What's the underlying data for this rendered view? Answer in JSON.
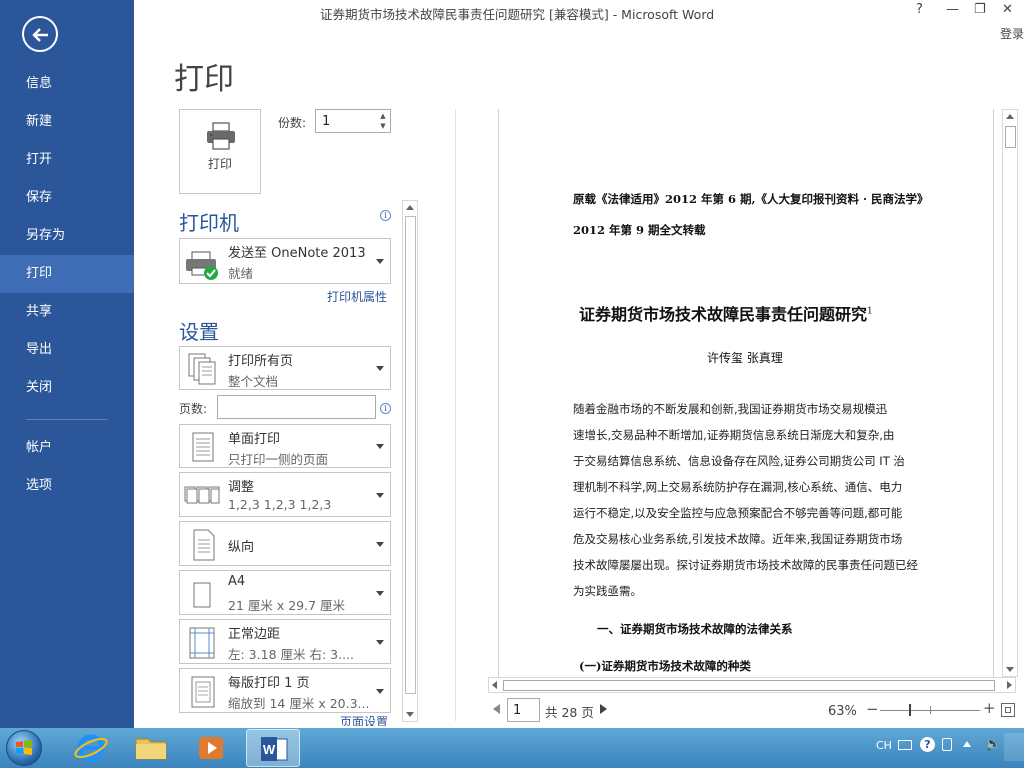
{
  "window": {
    "title": "证券期货市场技术故障民事责任问题研究 [兼容模式] - Microsoft Word",
    "help": "?",
    "minimize": "—",
    "restore": "❐",
    "close": "✕",
    "login": "登录"
  },
  "sidebar": {
    "items": [
      {
        "label": "信息"
      },
      {
        "label": "新建"
      },
      {
        "label": "打开"
      },
      {
        "label": "保存"
      },
      {
        "label": "另存为"
      },
      {
        "label": "打印",
        "active": true
      },
      {
        "label": "共享"
      },
      {
        "label": "导出"
      },
      {
        "label": "关闭"
      },
      {
        "label": "帐户"
      },
      {
        "label": "选项"
      }
    ]
  },
  "print": {
    "page_title": "打印",
    "button_label": "打印",
    "copies_label": "份数:",
    "copies_value": "1",
    "printer_heading": "打印机",
    "printer_name": "发送至 OneNote 2013",
    "printer_status": "就绪",
    "printer_properties_link": "打印机属性",
    "settings_heading": "设置",
    "pages_label": "页数:",
    "pages_value": "",
    "page_setup_link": "页面设置",
    "settings": [
      {
        "line1": "打印所有页",
        "line2": "整个文档",
        "icon": "pages-stack-icon"
      },
      {
        "line1": "单面打印",
        "line2": "只打印一侧的页面",
        "icon": "one-sided-icon"
      },
      {
        "line1": "调整",
        "line2": "1,2,3    1,2,3    1,2,3",
        "icon": "collate-icon"
      },
      {
        "line1": "纵向",
        "line2": "",
        "icon": "portrait-icon"
      },
      {
        "line1": "A4",
        "line2": "21 厘米 x 29.7 厘米",
        "icon": "paper-size-icon"
      },
      {
        "line1": "正常边距",
        "line2": "左: 3.18 厘米    右: 3....",
        "icon": "margins-icon"
      },
      {
        "line1": "每版打印 1 页",
        "line2": "缩放到 14 厘米 x 20.3...",
        "icon": "pages-per-sheet-icon"
      }
    ]
  },
  "preview": {
    "header_line1": "原载《法律适用》2012 年第 6 期,《人大复印报刊资料 · 民商法学》",
    "header_line2": "2012 年第 9 期全文转载",
    "doc_title": "证券期货市场技术故障民事责任问题研究",
    "doc_title_sup": "1",
    "authors": "许传玺  张真理",
    "body": [
      "    随着金融市场的不断发展和创新,我国证券期货市场交易规模迅",
      "速增长,交易品种不断增加,证券期货信息系统日渐庞大和复杂,由",
      "于交易结算信息系统、信息设备存在风险,证券公司期货公司 IT 治",
      "理机制不科学,网上交易系统防护存在漏洞,核心系统、通信、电力",
      "运行不稳定,以及安全监控与应急预案配合不够完善等问题,都可能",
      "危及交易核心业务系统,引发技术故障。近年来,我国证券期货市场",
      "技术故障屡屡出现。探讨证券期货市场技术故障的民事责任问题已经",
      "为实践亟需。"
    ],
    "section1": "一、证券期货市场技术故障的法律关系",
    "section2": "(一)证券期货市场技术故障的种类"
  },
  "pagenav": {
    "current_page": "1",
    "total": "共 28 页"
  },
  "zoom": {
    "percent": "63%",
    "minus": "−",
    "plus": "+",
    "level": 0.63
  },
  "taskbar": {
    "lang": "CH"
  },
  "colors": {
    "accent": "#2b579a",
    "active_item": "#3e6db5",
    "printer_ok": "#27a844"
  }
}
